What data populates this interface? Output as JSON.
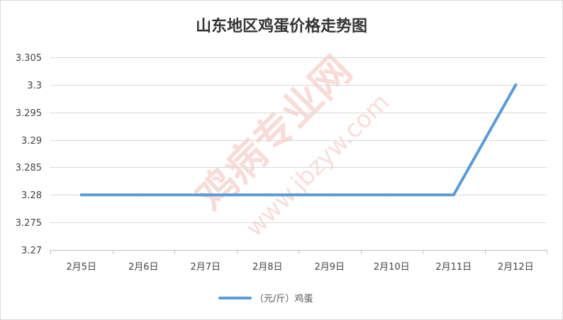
{
  "chart_data": {
    "type": "line",
    "title": "山东地区鸡蛋价格走势图",
    "categories": [
      "2月5日",
      "2月6日",
      "2月7日",
      "2月8日",
      "2月9日",
      "2月10日",
      "2月11日",
      "2月12日"
    ],
    "series": [
      {
        "name": "（元/斤）鸡蛋",
        "values": [
          3.28,
          3.28,
          3.28,
          3.28,
          3.28,
          3.28,
          3.28,
          3.3
        ],
        "color": "#5b9bd5"
      }
    ],
    "ylim": [
      3.27,
      3.305
    ],
    "yticks": [
      "3.27",
      "3.275",
      "3.28",
      "3.285",
      "3.29",
      "3.295",
      "3.3",
      "3.305"
    ],
    "grid": true,
    "legend_position": "bottom"
  },
  "watermark": {
    "main": "鸡病专业网",
    "url": "www.jbzyw.com"
  }
}
